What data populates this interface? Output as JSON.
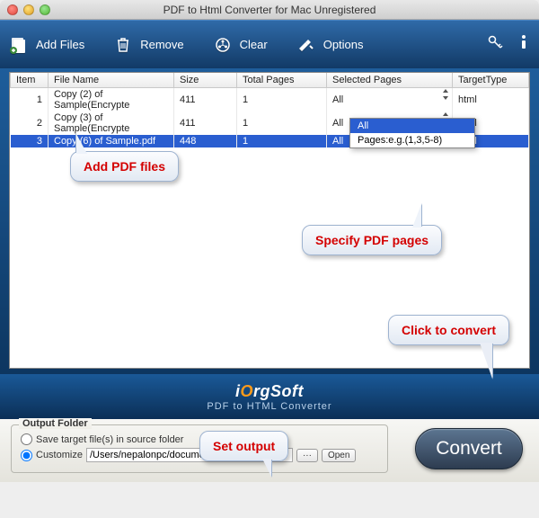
{
  "window": {
    "title": "PDF to Html Converter for Mac Unregistered"
  },
  "toolbar": {
    "add_files": "Add Files",
    "remove": "Remove",
    "clear": "Clear",
    "options": "Options"
  },
  "table": {
    "headers": {
      "item": "Item",
      "file_name": "File Name",
      "size": "Size",
      "total_pages": "Total Pages",
      "selected_pages": "Selected Pages",
      "target_type": "TargetType"
    },
    "rows": [
      {
        "item": "1",
        "file_name": "Copy (2) of Sample(Encrypte",
        "size": "411",
        "total_pages": "1",
        "selected_pages": "All",
        "target_type": "html",
        "selected": false
      },
      {
        "item": "2",
        "file_name": "Copy (3) of Sample(Encrypte",
        "size": "411",
        "total_pages": "1",
        "selected_pages": "All",
        "target_type": "html",
        "selected": false
      },
      {
        "item": "3",
        "file_name": "Copy (6) of Sample.pdf",
        "size": "448",
        "total_pages": "1",
        "selected_pages": "All",
        "target_type": "html",
        "selected": true
      }
    ]
  },
  "dropdown": {
    "opt_all": "All",
    "opt_pages": "Pages:e.g.(1,3,5-8)"
  },
  "brand": {
    "name_pre": "i",
    "name_o": "O",
    "name_rest": "rgSoft",
    "sub": "PDF to HTML Converter"
  },
  "output": {
    "group": "Output Folder",
    "save_source": "Save target file(s) in source folder",
    "customize": "Customize",
    "path": "/Users/nepalonpc/documents/iOrgS",
    "browse": "···",
    "open": "Open"
  },
  "convert": "Convert",
  "callouts": {
    "add": "Add PDF files",
    "pages": "Specify PDF pages",
    "convert": "Click to convert",
    "output": "Set output"
  }
}
